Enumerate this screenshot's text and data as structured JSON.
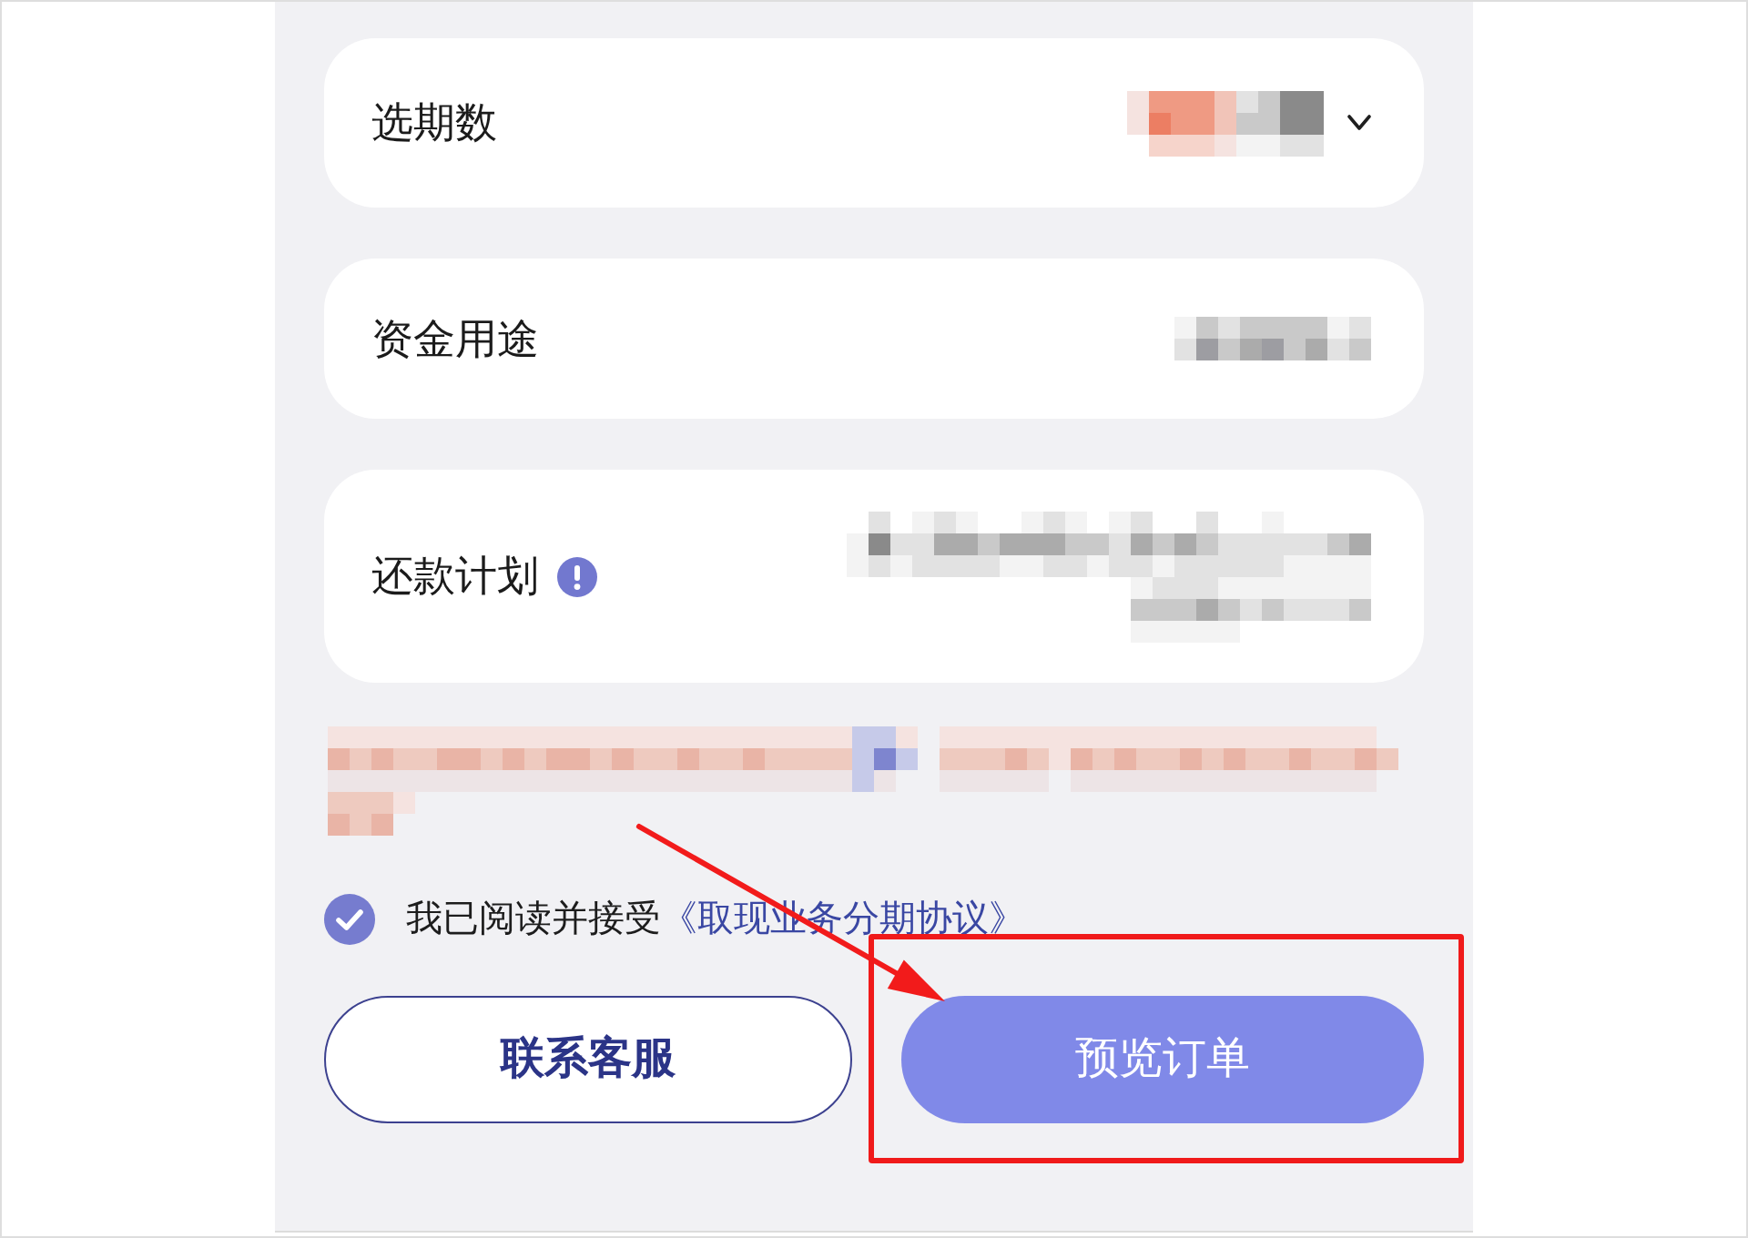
{
  "form_fields": [
    {
      "label": "选期数",
      "kind": "select"
    },
    {
      "label": "资金用途",
      "kind": "plain"
    },
    {
      "label": "还款计划",
      "kind": "info"
    }
  ],
  "agreement": {
    "checked": true,
    "text": "我已阅读并接受",
    "link": "《取现业务分期协议》"
  },
  "buttons": [
    {
      "label": "联系客服",
      "kind": "outline"
    },
    {
      "label": "预览订单",
      "kind": "primary"
    }
  ]
}
